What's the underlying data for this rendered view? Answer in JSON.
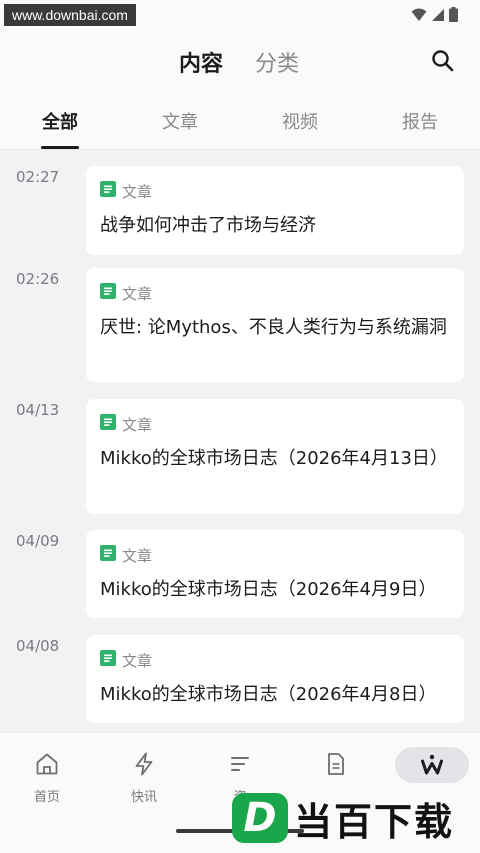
{
  "status_bar": {
    "watermark": "www.downbai.com",
    "icons": [
      "wifi-icon",
      "signal-icon",
      "battery-icon"
    ]
  },
  "header": {
    "tabs": [
      {
        "label": "内容",
        "active": true
      },
      {
        "label": "分类",
        "active": false
      }
    ],
    "search_icon": "search-icon"
  },
  "subtabs": [
    {
      "label": "全部",
      "active": true
    },
    {
      "label": "文章",
      "active": false
    },
    {
      "label": "视频",
      "active": false
    },
    {
      "label": "报告",
      "active": false
    }
  ],
  "feed": [
    {
      "time": "02:27",
      "type": "文章",
      "title": "战争如何冲击了市场与经济"
    },
    {
      "time": "02:26",
      "type": "文章",
      "title": "厌世: 论Mythos、不良人类行为与系统漏洞"
    },
    {
      "time": "04/13",
      "type": "文章",
      "title": "Mikko的全球市场日志（2026年4月13日）"
    },
    {
      "time": "04/09",
      "type": "文章",
      "title": "Mikko的全球市场日志（2026年4月9日）"
    },
    {
      "time": "04/08",
      "type": "文章",
      "title": "Mikko的全球市场日志（2026年4月8日）"
    }
  ],
  "bottom_nav": [
    {
      "label": "首页",
      "icon": "home-icon",
      "active": false
    },
    {
      "label": "快讯",
      "icon": "lightning-icon",
      "active": false
    },
    {
      "label": "资",
      "icon": "list-icon",
      "active": false
    },
    {
      "label": "",
      "icon": "document-icon",
      "active": false
    },
    {
      "label": "",
      "icon": "brand-w-icon",
      "active": true
    }
  ],
  "logo_watermark": {
    "letter": "D",
    "text": "当百下载"
  },
  "colors": {
    "accent_green": "#2fb36c",
    "text_primary": "#1c1c1e",
    "text_secondary": "#8a8a8e",
    "background": "#f2f2f4"
  }
}
